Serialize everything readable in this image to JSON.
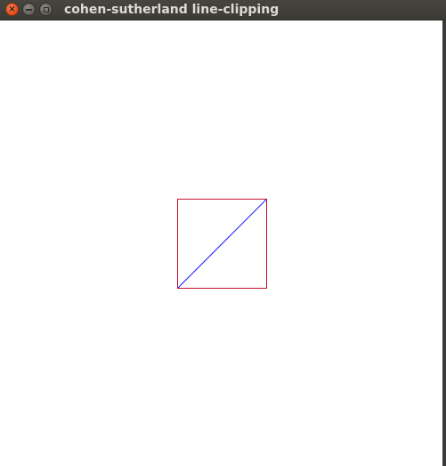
{
  "window": {
    "title": "cohen-sutherland line-clipping"
  },
  "titlebar_buttons": {
    "close_icon": "close-icon",
    "minimize_icon": "minimize-icon",
    "maximize_icon": "maximize-icon"
  },
  "colors": {
    "titlebar": "#3c3b37",
    "close_button": "#df4a16",
    "clip_window_border": "#c8102e",
    "clipped_line": "#1a1aff",
    "canvas_background": "#ffffff"
  }
}
